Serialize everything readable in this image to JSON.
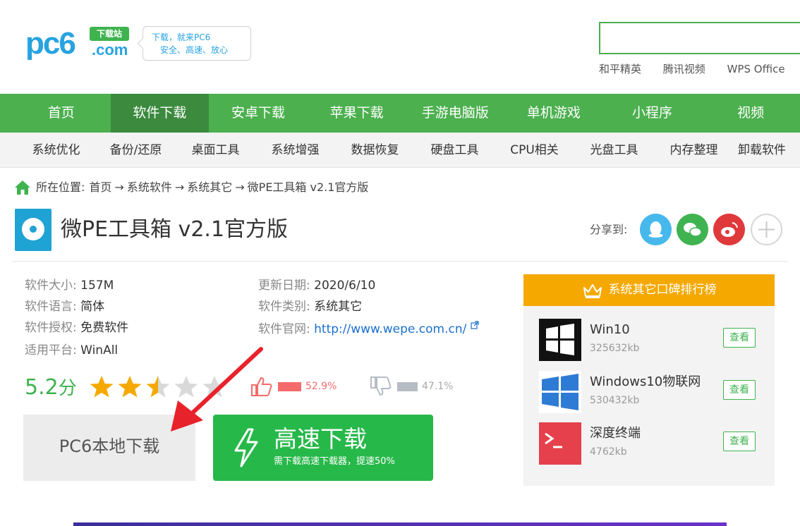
{
  "logo": {
    "text": "pc6",
    "badge": "下载站",
    "suffix": ".com"
  },
  "slogan": {
    "line1": "下载，就来PC6",
    "line2": "安全、高速、放心"
  },
  "search": {
    "placeholder": ""
  },
  "hot_links": [
    "和平精英",
    "腾讯视频",
    "WPS Office"
  ],
  "main_nav": [
    "首页",
    "软件下载",
    "安卓下载",
    "苹果下载",
    "手游电脑版",
    "单机游戏",
    "小程序",
    "视频"
  ],
  "main_nav_active": 1,
  "sub_nav": [
    "系统优化",
    "备份/还原",
    "桌面工具",
    "系统增强",
    "数据恢复",
    "硬盘工具",
    "CPU相关",
    "光盘工具",
    "内存整理",
    "卸载软件"
  ],
  "breadcrumb": {
    "label": "所在位置:",
    "items": [
      "首页",
      "系统软件",
      "系统其它",
      "微PE工具箱 v2.1官方版"
    ],
    "sep": "→"
  },
  "app": {
    "title": "微PE工具箱 v2.1官方版"
  },
  "share": {
    "label": "分享到:"
  },
  "info": {
    "size": {
      "k": "软件大小:",
      "v": "157M"
    },
    "lang": {
      "k": "软件语言:",
      "v": "简体"
    },
    "license": {
      "k": "软件授权:",
      "v": "免费软件"
    },
    "platform": {
      "k": "适用平台:",
      "v": "WinAll"
    },
    "date": {
      "k": "更新日期:",
      "v": "2020/6/10"
    },
    "category": {
      "k": "软件类别:",
      "v": "系统其它"
    },
    "site": {
      "k": "软件官网:",
      "v": "http://www.wepe.com.cn/"
    }
  },
  "rating": {
    "score": "5.2",
    "unit": "分",
    "stars": 2.5,
    "up": "52.9%",
    "down": "47.1%"
  },
  "download": {
    "local": "PC6本地下载",
    "fast_title": "高速下载",
    "fast_sub": "需下载高速下载器，提速50%"
  },
  "ranking": {
    "title": "系统其它口碑排行榜",
    "items": [
      {
        "name": "Win10",
        "size": "325632kb",
        "btn": "查看"
      },
      {
        "name": "Windows10物联网",
        "size": "530432kb",
        "btn": "查看"
      },
      {
        "name": "深度终端",
        "size": "4762kb",
        "btn": "查看"
      }
    ]
  },
  "colors": {
    "brand_green": "#4cb04f",
    "nav_active": "#3b8a3e",
    "accent_orange": "#f5a900",
    "link_blue": "#1c6fcf"
  }
}
